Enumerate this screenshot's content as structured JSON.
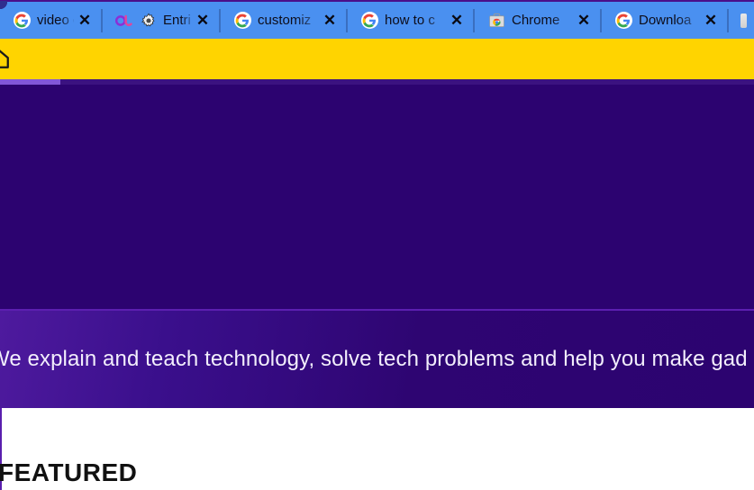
{
  "window": {
    "tabstrip_bg": "#4a90f0",
    "toolbar_bg": "#ffd400",
    "page_bg": "#2c0370"
  },
  "tabstrip": {
    "tabs": [
      {
        "title": "video ca",
        "favicon": "google-g-icon",
        "second_favicon": null,
        "close_label": "✕",
        "active": false
      },
      {
        "title": "Entri",
        "favicon": "ol-logo-icon",
        "second_favicon": "gear-icon",
        "close_label": "✕",
        "active": false
      },
      {
        "title": "customiz",
        "favicon": "google-g-icon",
        "second_favicon": null,
        "close_label": "✕",
        "active": false
      },
      {
        "title": "how to c",
        "favicon": "google-g-icon",
        "second_favicon": null,
        "close_label": "✕",
        "active": false
      },
      {
        "title": "Chrome",
        "favicon": "chrome-web-store-icon",
        "second_favicon": null,
        "close_label": "✕",
        "active": false
      },
      {
        "title": "Downloa",
        "favicon": "google-g-icon",
        "second_favicon": null,
        "close_label": "✕",
        "active": false
      },
      {
        "title": "",
        "favicon": "partial-tab-icon",
        "second_favicon": null,
        "close_label": "",
        "active": false
      }
    ]
  },
  "toolbar": {
    "home_icon": "home-icon",
    "omnibox": {
      "lock_icon": "lock-icon",
      "value": "",
      "placeholder": ""
    }
  },
  "progress": {
    "percent": 8,
    "fill_color": "#8257d8",
    "track_color": "#3b1280"
  },
  "page": {
    "tagline": "We explain and teach technology, solve tech problems and help you make gad",
    "featured_heading": "FEATURED",
    "accent_rule_color": "#5c1fb0",
    "white_section_border": "#5a1fae"
  }
}
